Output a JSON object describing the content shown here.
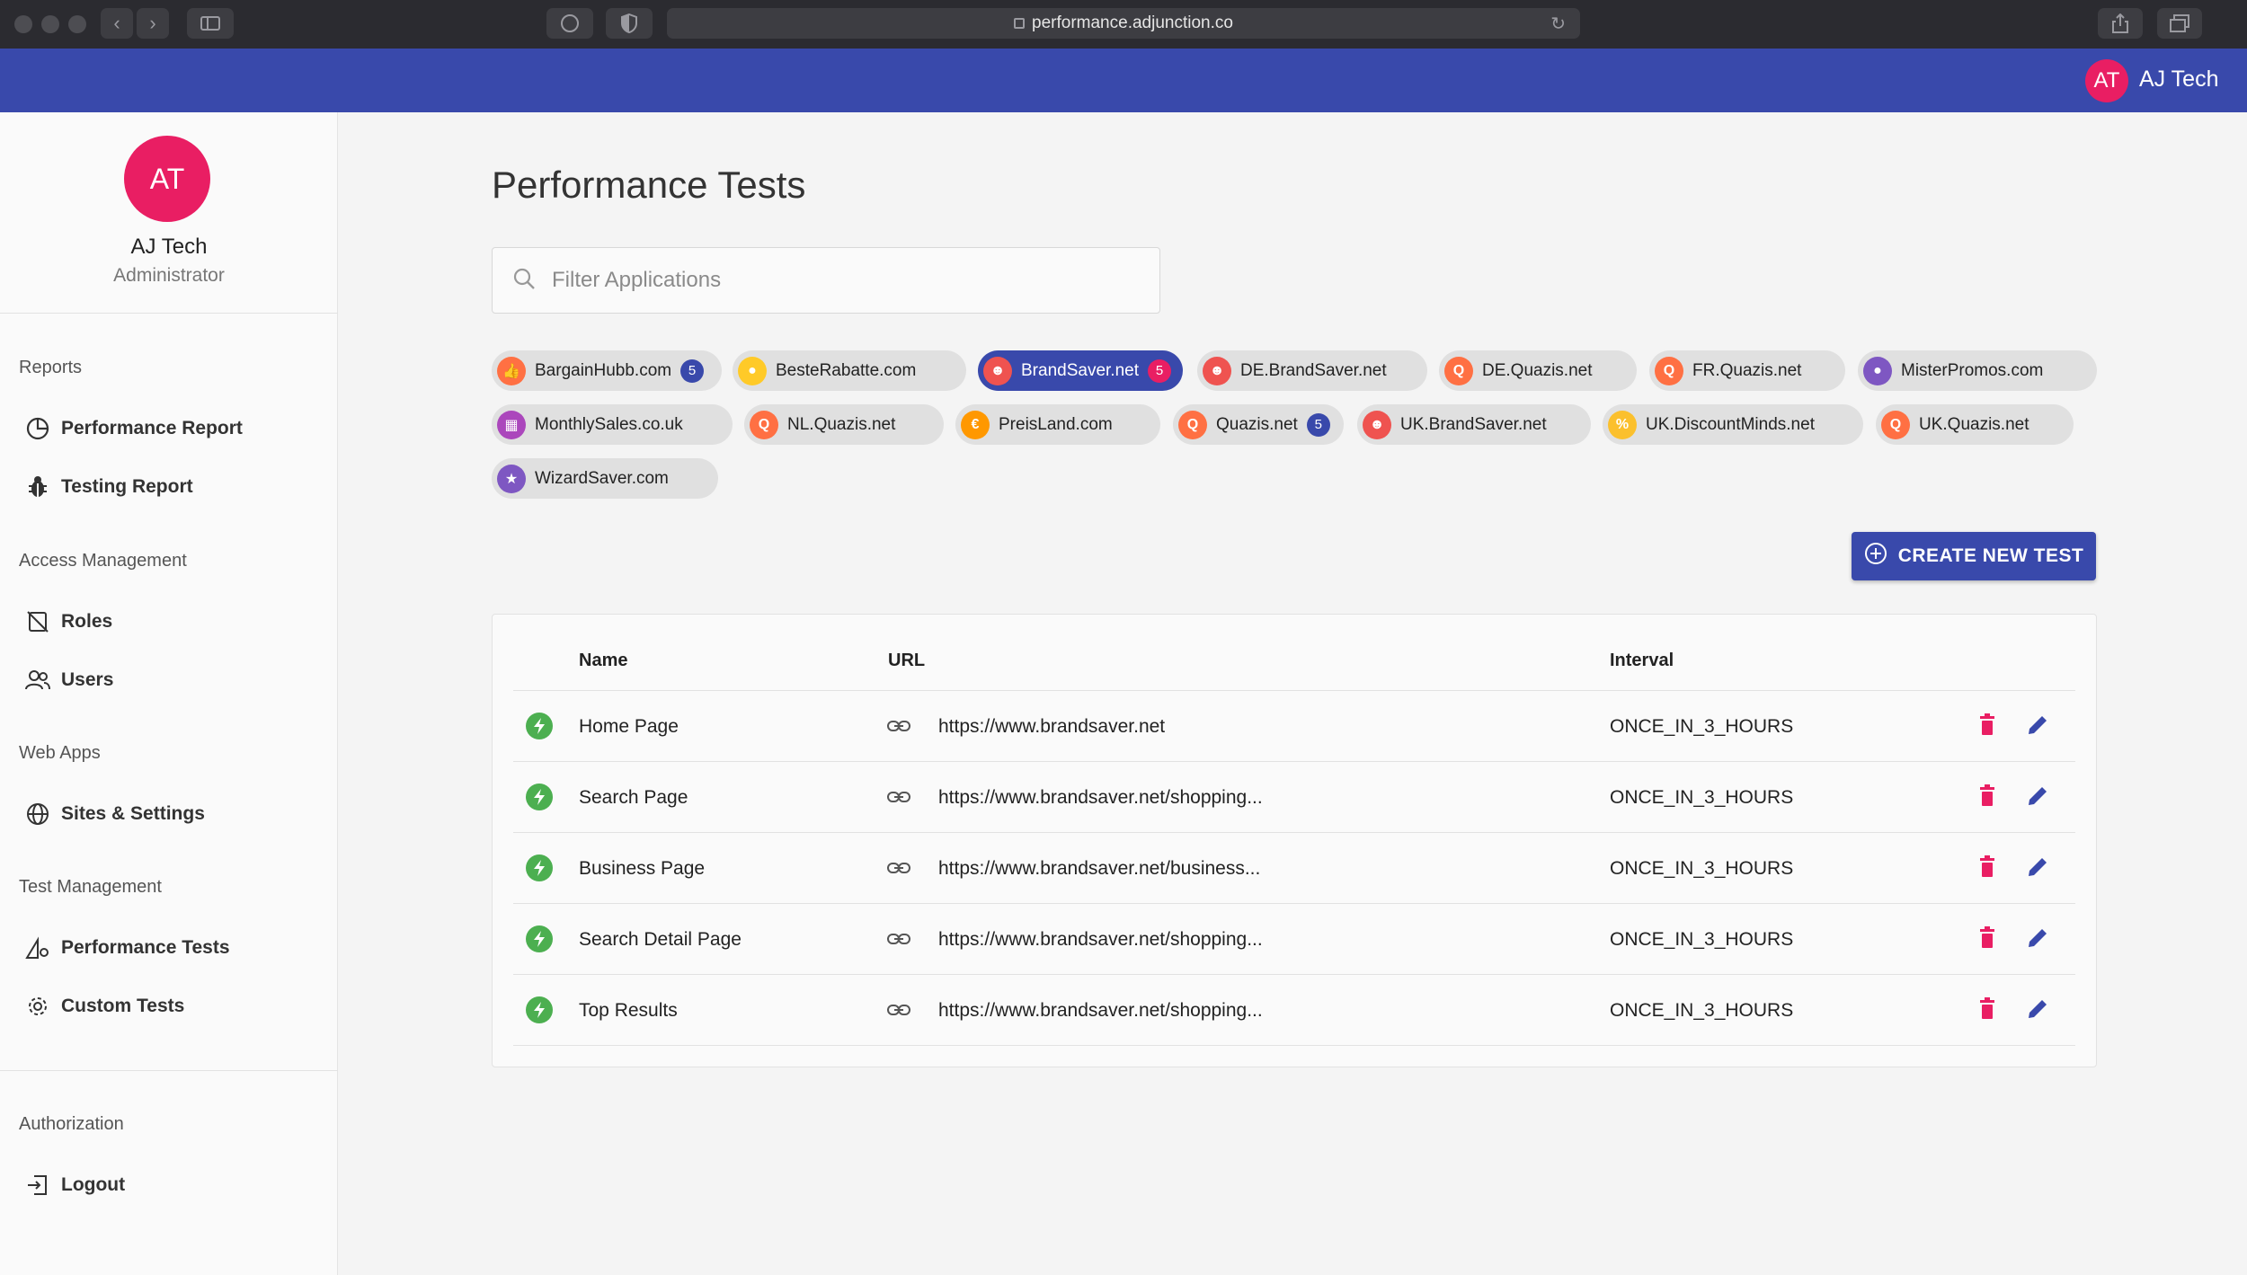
{
  "browser": {
    "url": "performance.adjunction.co"
  },
  "appbar": {
    "avatar_initials": "AT",
    "user_name": "AJ Tech"
  },
  "sidebar": {
    "avatar_initials": "AT",
    "name": "AJ Tech",
    "role": "Administrator",
    "sections": {
      "reports": "Reports",
      "access": "Access Management",
      "webapps": "Web Apps",
      "testmgmt": "Test Management",
      "auth": "Authorization"
    },
    "items": {
      "performance_report": "Performance Report",
      "testing_report": "Testing Report",
      "roles": "Roles",
      "users": "Users",
      "sites_settings": "Sites & Settings",
      "performance_tests": "Performance Tests",
      "custom_tests": "Custom Tests",
      "logout": "Logout"
    }
  },
  "main": {
    "title": "Performance Tests",
    "filter_placeholder": "Filter Applications",
    "create_button": "CREATE NEW TEST"
  },
  "chips": [
    {
      "label": "BargainHubb.com",
      "badge": "5",
      "icon_color": "#ff7043",
      "icon": "thumbs-up-icon",
      "glyph": "👍"
    },
    {
      "label": "BesteRabatte.com",
      "badge": "",
      "icon_color": "#ffca28",
      "icon": "shopping-bag-icon",
      "glyph": "●"
    },
    {
      "label": "BrandSaver.net",
      "badge": "5",
      "icon_color": "#ef5350",
      "icon": "mascot-icon",
      "glyph": "☻",
      "active": true
    },
    {
      "label": "DE.BrandSaver.net",
      "badge": "",
      "icon_color": "#ef5350",
      "icon": "mascot-icon",
      "glyph": "☻"
    },
    {
      "label": "DE.Quazis.net",
      "badge": "",
      "icon_color": "#ff7043",
      "icon": "search-q-icon",
      "glyph": "Q"
    },
    {
      "label": "FR.Quazis.net",
      "badge": "",
      "icon_color": "#ff7043",
      "icon": "search-q-icon",
      "glyph": "Q"
    },
    {
      "label": "MisterPromos.com",
      "badge": "",
      "icon_color": "#7e57c2",
      "icon": "hat-icon",
      "glyph": "●"
    },
    {
      "label": "MonthlySales.co.uk",
      "badge": "",
      "icon_color": "#ab47bc",
      "icon": "calendar-icon",
      "glyph": "▦"
    },
    {
      "label": "NL.Quazis.net",
      "badge": "",
      "icon_color": "#ff7043",
      "icon": "search-q-icon",
      "glyph": "Q"
    },
    {
      "label": "PreisLand.com",
      "badge": "",
      "icon_color": "#ff9800",
      "icon": "euro-pin-icon",
      "glyph": "€"
    },
    {
      "label": "Quazis.net",
      "badge": "5",
      "icon_color": "#ff7043",
      "icon": "search-q-icon",
      "glyph": "Q"
    },
    {
      "label": "UK.BrandSaver.net",
      "badge": "",
      "icon_color": "#ef5350",
      "icon": "mascot-icon",
      "glyph": "☻"
    },
    {
      "label": "UK.DiscountMinds.net",
      "badge": "",
      "icon_color": "#fbc02d",
      "icon": "lightbulb-icon",
      "glyph": "%"
    },
    {
      "label": "UK.Quazis.net",
      "badge": "",
      "icon_color": "#ff7043",
      "icon": "search-q-icon",
      "glyph": "Q"
    },
    {
      "label": "WizardSaver.com",
      "badge": "",
      "icon_color": "#7e57c2",
      "icon": "wizard-icon",
      "glyph": "★"
    }
  ],
  "table": {
    "headers": {
      "name": "Name",
      "url": "URL",
      "interval": "Interval"
    },
    "rows": [
      {
        "name": "Home Page",
        "url": "https://www.brandsaver.net",
        "interval": "ONCE_IN_3_HOURS"
      },
      {
        "name": "Search Page",
        "url": "https://www.brandsaver.net/shopping...",
        "interval": "ONCE_IN_3_HOURS"
      },
      {
        "name": "Business Page",
        "url": "https://www.brandsaver.net/business...",
        "interval": "ONCE_IN_3_HOURS"
      },
      {
        "name": "Search Detail Page",
        "url": "https://www.brandsaver.net/shopping...",
        "interval": "ONCE_IN_3_HOURS"
      },
      {
        "name": "Top Results",
        "url": "https://www.brandsaver.net/shopping...",
        "interval": "ONCE_IN_3_HOURS"
      }
    ]
  },
  "colors": {
    "primary": "#3949ab",
    "accent": "#e91e63",
    "success": "#4caf50",
    "delete": "#e91e63"
  }
}
